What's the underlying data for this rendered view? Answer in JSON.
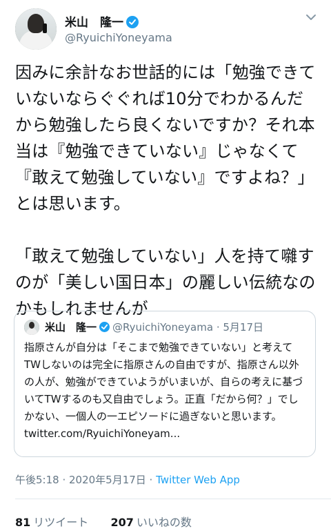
{
  "author": {
    "name": "米山　隆一",
    "handle": "@RyuichiYoneyama"
  },
  "tweet": {
    "paragraphs": [
      "因みに余計なお世話的には「勉強できていないならぐぐれば10分でわかるんだから勉強したら良くないですか？それ本当は『勉強できていない』じゃなくて『敢えて勉強していない』ですよね？」とは思います。",
      "「敢えて勉強していない」人を持て囃すのが「美しい国日本」の麗しい伝統なのかもしれませんが"
    ]
  },
  "quoted": {
    "name": "米山　隆一",
    "handle": "@RyuichiYoneyama",
    "separator": "·",
    "date": "5月17日",
    "text": "指原さんが自分は「そこまで勉強できていない」と考えてTWしないのは完全に指原さんの自由ですが、指原さん以外の人が、勉強ができていようがいまいが、自らの考えに基づいてTWするのも又自由でしょう。正直「だから何？」でしかない、一個人の一エピソードに過ぎないと思います。",
    "link": "twitter.com/RyuichiYoneyam..."
  },
  "footer": {
    "time": "午後5:18 · 2020年5月17日 ·",
    "app": "Twitter Web App"
  },
  "stats": {
    "retweets_count": "81",
    "retweets_label": "リツイート",
    "likes_count": "207",
    "likes_label": "いいねの数"
  },
  "icons": {
    "verified": "verified-badge-icon",
    "menu": "chevron-down-icon"
  },
  "colors": {
    "accent": "#1da1f2",
    "secondary_text": "#657786",
    "border": "#ccd6dd"
  }
}
